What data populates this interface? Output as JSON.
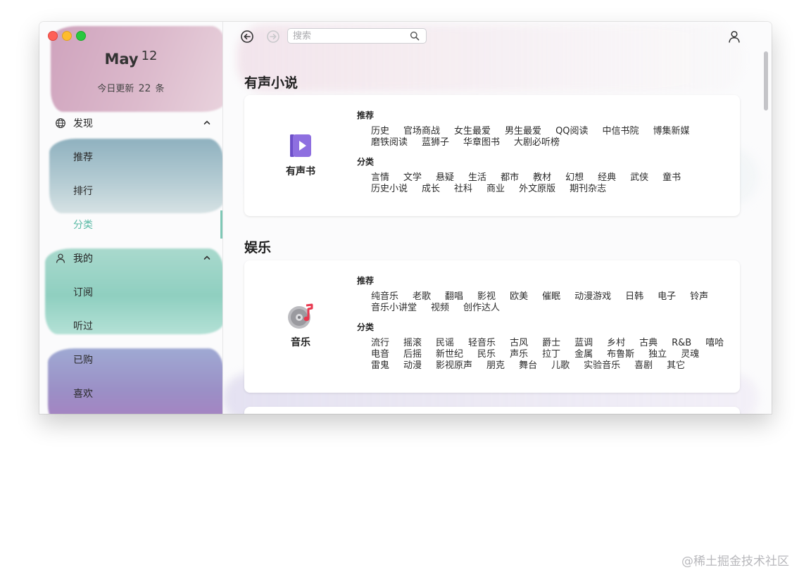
{
  "sidebar": {
    "date": {
      "month": "May",
      "day": "12"
    },
    "update": {
      "prefix": "今日更新",
      "count": "22",
      "suffix": "条"
    },
    "discover": {
      "label": "发现",
      "items": [
        "推荐",
        "排行",
        "分类"
      ]
    },
    "mine": {
      "label": "我的",
      "items": [
        "订阅",
        "听过",
        "已购",
        "喜欢"
      ]
    },
    "active_item": "分类"
  },
  "toolbar": {
    "search_placeholder": "搜索",
    "icons": [
      "back-icon",
      "forward-icon",
      "search-icon",
      "user-icon"
    ]
  },
  "sections": [
    {
      "title": "有声小说",
      "card_label": "有声书",
      "card_icon": "audiobook-icon",
      "recommend_title": "推荐",
      "recommend_rows": [
        [
          "历史",
          "官场商战",
          "女生最爱",
          "男生最爱",
          "QQ阅读",
          "中信书院",
          "博集新媒"
        ],
        [
          "磨铁阅读",
          "蓝狮子",
          "华章图书",
          "大剧必听榜"
        ]
      ],
      "category_title": "分类",
      "category_rows": [
        [
          "言情",
          "文学",
          "悬疑",
          "生活",
          "都市",
          "教材",
          "幻想",
          "经典",
          "武侠",
          "童书"
        ],
        [
          "历史小说",
          "成长",
          "社科",
          "商业",
          "外文原版",
          "期刊杂志"
        ]
      ]
    },
    {
      "title": "娱乐",
      "card_label": "音乐",
      "card_icon": "music-disc-icon",
      "recommend_title": "推荐",
      "recommend_rows": [
        [
          "纯音乐",
          "老歌",
          "翻唱",
          "影视",
          "欧美",
          "催眠",
          "动漫游戏",
          "日韩",
          "电子",
          "铃声"
        ],
        [
          "音乐小讲堂",
          "视频",
          "创作达人"
        ]
      ],
      "category_title": "分类",
      "category_rows": [
        [
          "流行",
          "摇滚",
          "民谣",
          "轻音乐",
          "古风",
          "爵士",
          "蓝调",
          "乡村",
          "古典",
          "R&B",
          "嘻哈"
        ],
        [
          "电音",
          "后摇",
          "新世纪",
          "民乐",
          "声乐",
          "拉丁",
          "金属",
          "布鲁斯",
          "独立",
          "灵魂"
        ],
        [
          "雷鬼",
          "动漫",
          "影视原声",
          "朋克",
          "舞台",
          "儿歌",
          "实验音乐",
          "喜剧",
          "其它"
        ]
      ]
    }
  ],
  "colors": {
    "accent": "#57b9a4",
    "traffic_close": "#fe5f57",
    "traffic_min": "#febc2e",
    "traffic_max": "#28c840",
    "audiobook_icon": "#8e6fe0",
    "music_note": "#e8384f"
  },
  "watermark": "@稀土掘金技术社区"
}
